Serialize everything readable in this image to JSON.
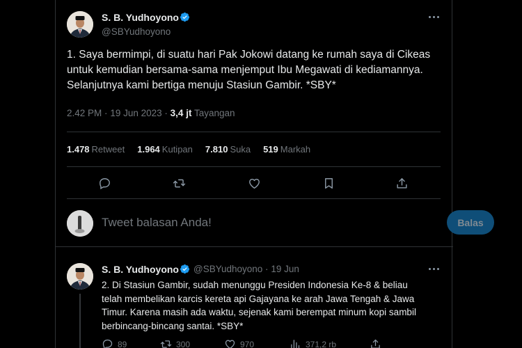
{
  "main_tweet": {
    "display_name": "S. B. Yudhoyono",
    "handle": "@SBYudhoyono",
    "text_lines": [
      "1. Saya bermimpi, di suatu hari Pak Jokowi datang ke rumah saya di Cikeas",
      "untuk kemudian bersama-sama menjemput Ibu Megawati di kediamannya.",
      "Selanjutnya kami bertiga menuju Stasiun Gambir. *SBY*"
    ],
    "time": "2.42 PM",
    "date": "19 Jun 2023",
    "separator": "·",
    "views_count": "3,4 jt",
    "views_label": "Tayangan",
    "stats": [
      {
        "count": "1.478",
        "label": "Retweet"
      },
      {
        "count": "1.964",
        "label": "Kutipan"
      },
      {
        "count": "7.810",
        "label": "Suka"
      },
      {
        "count": "519",
        "label": "Markah"
      }
    ]
  },
  "reply_box": {
    "placeholder": "Tweet balasan Anda!",
    "button_label": "Balas"
  },
  "thread_tweet": {
    "display_name": "S. B. Yudhoyono",
    "handle": "@SBYudhoyono",
    "separator": "·",
    "date": "19 Jun",
    "text_lines": [
      "2. Di Stasiun Gambir, sudah menunggu Presiden Indonesia Ke-8 & beliau",
      "telah membelikan karcis kereta api Gajayana ke arah Jawa Tengah & Jawa",
      "Timur. Karena masih ada waktu, sejenak kami berempat minum kopi sambil",
      "berbincang-bincang santai. *SBY*"
    ],
    "actions": {
      "replies": "89",
      "retweets": "300",
      "likes": "970",
      "views": "371,2 rb"
    }
  },
  "icons": {
    "verified": "verified-badge-icon",
    "more": "more-icon",
    "reply": "reply-icon",
    "retweet": "retweet-icon",
    "like": "like-icon",
    "bookmark": "bookmark-icon",
    "share": "share-icon",
    "views": "views-icon"
  },
  "colors": {
    "background": "#000000",
    "text": "#e7e9ea",
    "muted": "#71767b",
    "border": "#2f3336",
    "verified": "#1d9bf0",
    "reply_button": "#0f4e78"
  }
}
